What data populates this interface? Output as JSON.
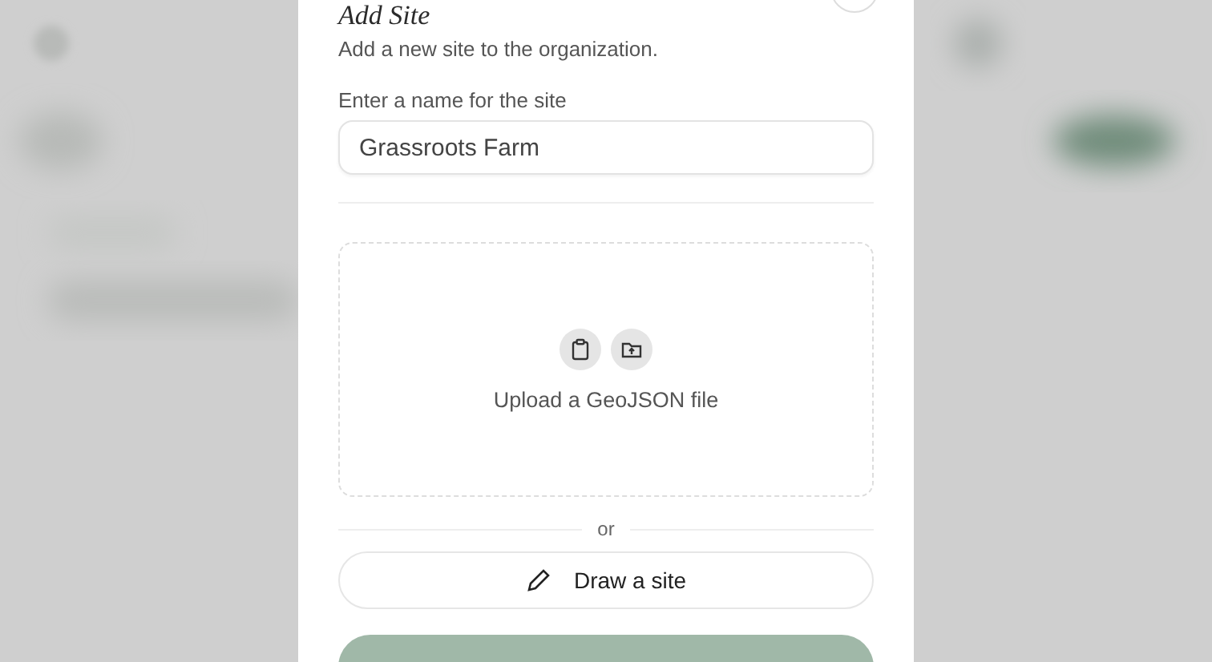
{
  "dialog": {
    "title": "Add Site",
    "subtitle": "Add a new site to the organization.",
    "name_field": {
      "label": "Enter a name for the site",
      "value": "Grassroots Farm"
    },
    "upload": {
      "label": "Upload a GeoJSON file"
    },
    "separator": "or",
    "draw_button": {
      "label": "Draw a site"
    }
  }
}
